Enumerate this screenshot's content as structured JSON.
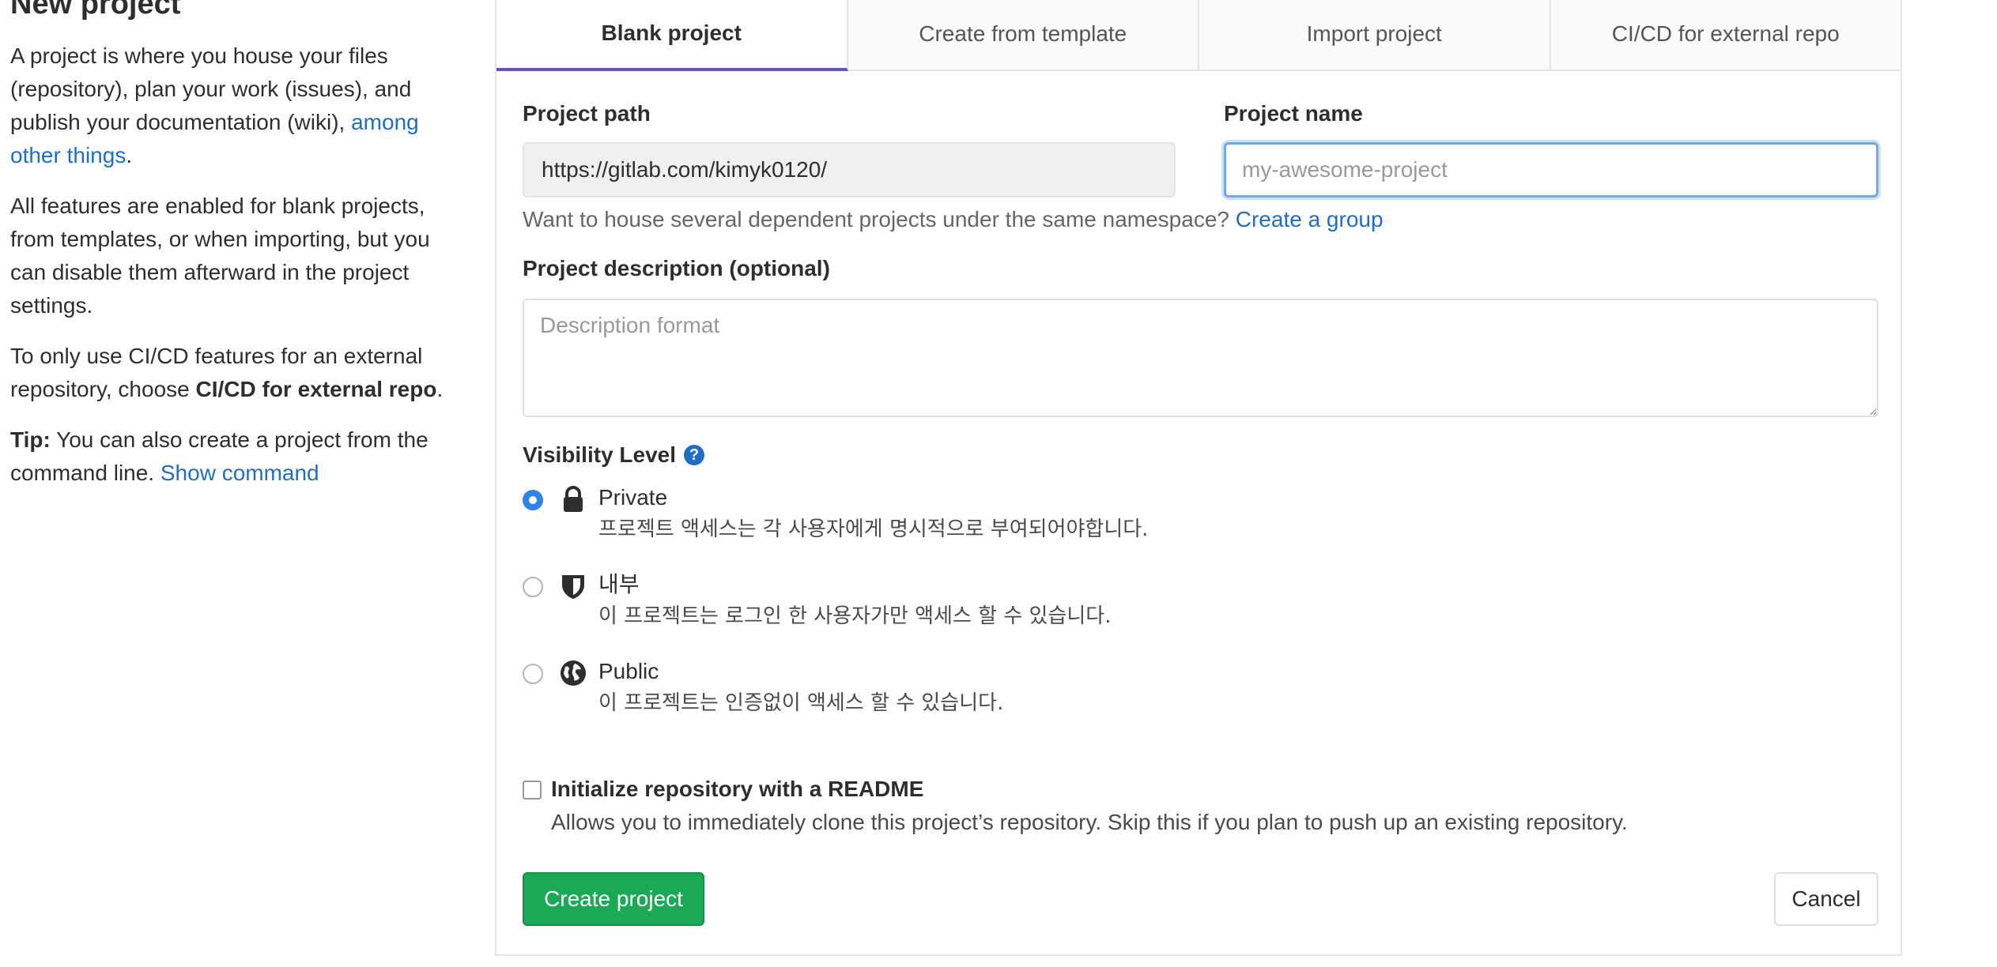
{
  "sidebar": {
    "title": "New project",
    "p1_text": "A project is where you house your files (repository), plan your work (issues), and publish your documentation (wiki), ",
    "p1_link": "among other things",
    "p1_end": ".",
    "p2_text": "All features are enabled for blank projects, from templates, or when importing, but you can disable them afterward in the project settings.",
    "p3_text": "To only use CI/CD features for an external repository, choose ",
    "p3_bold": "CI/CD for external repo",
    "p3_end": ".",
    "tip_label": "Tip:",
    "tip_text": " You can also create a project from the command line. ",
    "tip_link": "Show command"
  },
  "tabs": [
    {
      "label": "Blank project",
      "active": true
    },
    {
      "label": "Create from template",
      "active": false
    },
    {
      "label": "Import project",
      "active": false
    },
    {
      "label": "CI/CD for external repo",
      "active": false
    }
  ],
  "form": {
    "path_label": "Project path",
    "path_value": "https://gitlab.com/kimyk0120/",
    "name_label": "Project name",
    "name_placeholder": "my-awesome-project",
    "group_help": "Want to house several dependent projects under the same namespace? ",
    "group_link": "Create a group",
    "desc_label": "Project description (optional)",
    "desc_placeholder": "Description format",
    "visibility_label": "Visibility Level",
    "help_icon_glyph": "?",
    "visibility_options": [
      {
        "title": "Private",
        "desc": "프로젝트 액세스는 각 사용자에게 명시적으로 부여되어야합니다.",
        "icon": "lock-icon",
        "checked": true
      },
      {
        "title": "내부",
        "desc": "이 프로젝트는 로그인 한 사용자가만 액세스 할 수 있습니다.",
        "icon": "shield-icon",
        "checked": false
      },
      {
        "title": "Public",
        "desc": "이 프로젝트는 인증없이 액세스 할 수 있습니다.",
        "icon": "globe-icon",
        "checked": false
      }
    ],
    "readme_title": "Initialize repository with a README",
    "readme_desc": "Allows you to immediately clone this project’s repository. Skip this if you plan to push up an existing repository.",
    "create_label": "Create project",
    "cancel_label": "Cancel"
  },
  "colors": {
    "accent": "#6b4fbb",
    "link": "#1f6ec4",
    "primary_button": "#1aaa55",
    "radio_checked": "#2f84ea"
  }
}
